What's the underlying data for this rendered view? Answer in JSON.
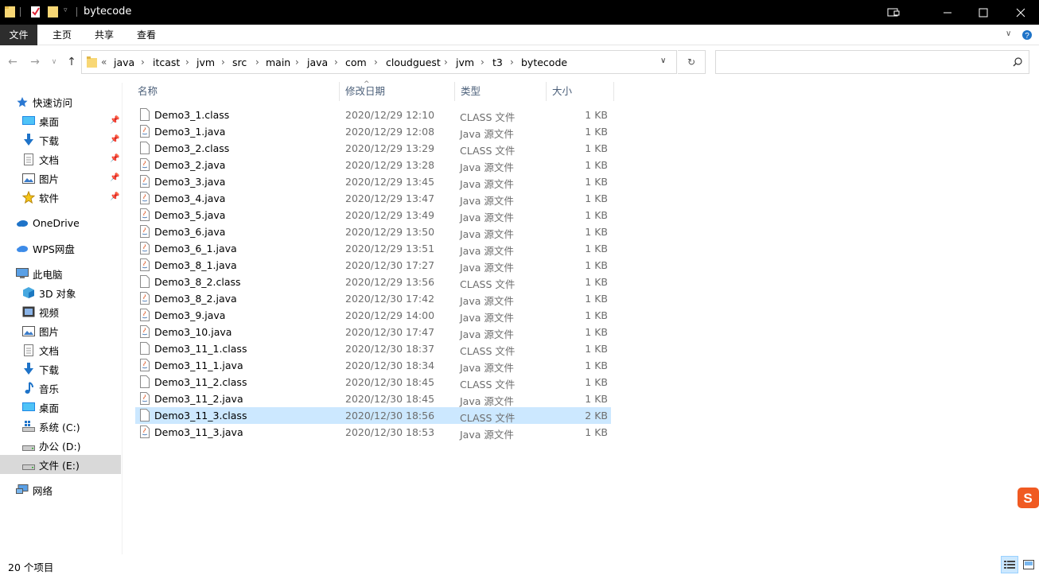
{
  "window": {
    "title": "bytecode",
    "controls": {
      "minimize": "minimize-icon",
      "maximize": "maximize-icon",
      "close": "close-icon"
    }
  },
  "ribbon": {
    "tabs": [
      "文件",
      "主页",
      "共享",
      "查看"
    ]
  },
  "address": {
    "overflow": "«",
    "crumbs": [
      "java",
      "itcast",
      "jvm",
      "src",
      "main",
      "java",
      "com",
      "cloudguest",
      "jvm",
      "t3",
      "bytecode"
    ]
  },
  "search": {
    "placeholder": ""
  },
  "sidebar": {
    "quick_access": "快速访问",
    "pinned": [
      {
        "label": "桌面",
        "icon": "desktop-icon"
      },
      {
        "label": "下载",
        "icon": "download-icon"
      },
      {
        "label": "文档",
        "icon": "document-icon"
      },
      {
        "label": "图片",
        "icon": "picture-icon"
      },
      {
        "label": "软件",
        "icon": "star-icon"
      }
    ],
    "onedrive": "OneDrive",
    "wps": "WPS网盘",
    "this_pc": "此电脑",
    "pc_items": [
      {
        "label": "3D 对象",
        "icon": "3d-objects-icon"
      },
      {
        "label": "视频",
        "icon": "video-icon"
      },
      {
        "label": "图片",
        "icon": "picture-icon"
      },
      {
        "label": "文档",
        "icon": "document-icon"
      },
      {
        "label": "下载",
        "icon": "download-icon"
      },
      {
        "label": "音乐",
        "icon": "music-icon"
      },
      {
        "label": "桌面",
        "icon": "desktop-icon"
      },
      {
        "label": "系统 (C:)",
        "icon": "drive-c-icon"
      },
      {
        "label": "办公 (D:)",
        "icon": "drive-icon"
      },
      {
        "label": "文件 (E:)",
        "icon": "drive-icon"
      }
    ],
    "network": "网络"
  },
  "columns": {
    "name": "名称",
    "modified": "修改日期",
    "type": "类型",
    "size": "大小"
  },
  "files": [
    {
      "name": "Demo3_1.class",
      "date": "2020/12/29 12:10",
      "type": "CLASS 文件",
      "size": "1 KB",
      "kind": "class"
    },
    {
      "name": "Demo3_1.java",
      "date": "2020/12/29 12:08",
      "type": "Java 源文件",
      "size": "1 KB",
      "kind": "java"
    },
    {
      "name": "Demo3_2.class",
      "date": "2020/12/29 13:29",
      "type": "CLASS 文件",
      "size": "1 KB",
      "kind": "class"
    },
    {
      "name": "Demo3_2.java",
      "date": "2020/12/29 13:28",
      "type": "Java 源文件",
      "size": "1 KB",
      "kind": "java"
    },
    {
      "name": "Demo3_3.java",
      "date": "2020/12/29 13:45",
      "type": "Java 源文件",
      "size": "1 KB",
      "kind": "java"
    },
    {
      "name": "Demo3_4.java",
      "date": "2020/12/29 13:47",
      "type": "Java 源文件",
      "size": "1 KB",
      "kind": "java"
    },
    {
      "name": "Demo3_5.java",
      "date": "2020/12/29 13:49",
      "type": "Java 源文件",
      "size": "1 KB",
      "kind": "java"
    },
    {
      "name": "Demo3_6.java",
      "date": "2020/12/29 13:50",
      "type": "Java 源文件",
      "size": "1 KB",
      "kind": "java"
    },
    {
      "name": "Demo3_6_1.java",
      "date": "2020/12/29 13:51",
      "type": "Java 源文件",
      "size": "1 KB",
      "kind": "java"
    },
    {
      "name": "Demo3_8_1.java",
      "date": "2020/12/30 17:27",
      "type": "Java 源文件",
      "size": "1 KB",
      "kind": "java"
    },
    {
      "name": "Demo3_8_2.class",
      "date": "2020/12/29 13:56",
      "type": "CLASS 文件",
      "size": "1 KB",
      "kind": "class"
    },
    {
      "name": "Demo3_8_2.java",
      "date": "2020/12/30 17:42",
      "type": "Java 源文件",
      "size": "1 KB",
      "kind": "java"
    },
    {
      "name": "Demo3_9.java",
      "date": "2020/12/29 14:00",
      "type": "Java 源文件",
      "size": "1 KB",
      "kind": "java"
    },
    {
      "name": "Demo3_10.java",
      "date": "2020/12/30 17:47",
      "type": "Java 源文件",
      "size": "1 KB",
      "kind": "java"
    },
    {
      "name": "Demo3_11_1.class",
      "date": "2020/12/30 18:37",
      "type": "CLASS 文件",
      "size": "1 KB",
      "kind": "class"
    },
    {
      "name": "Demo3_11_1.java",
      "date": "2020/12/30 18:34",
      "type": "Java 源文件",
      "size": "1 KB",
      "kind": "java"
    },
    {
      "name": "Demo3_11_2.class",
      "date": "2020/12/30 18:45",
      "type": "CLASS 文件",
      "size": "1 KB",
      "kind": "class"
    },
    {
      "name": "Demo3_11_2.java",
      "date": "2020/12/30 18:45",
      "type": "Java 源文件",
      "size": "1 KB",
      "kind": "java"
    },
    {
      "name": "Demo3_11_3.class",
      "date": "2020/12/30 18:56",
      "type": "CLASS 文件",
      "size": "2 KB",
      "kind": "class",
      "selected": true
    },
    {
      "name": "Demo3_11_3.java",
      "date": "2020/12/30 18:53",
      "type": "Java 源文件",
      "size": "1 KB",
      "kind": "java"
    }
  ],
  "status": {
    "count": "20 个项目"
  },
  "colors": {
    "selection": "#cce8ff",
    "titlebar": "#000000",
    "header_text": "#4c607a",
    "folder": "#f8d775"
  }
}
